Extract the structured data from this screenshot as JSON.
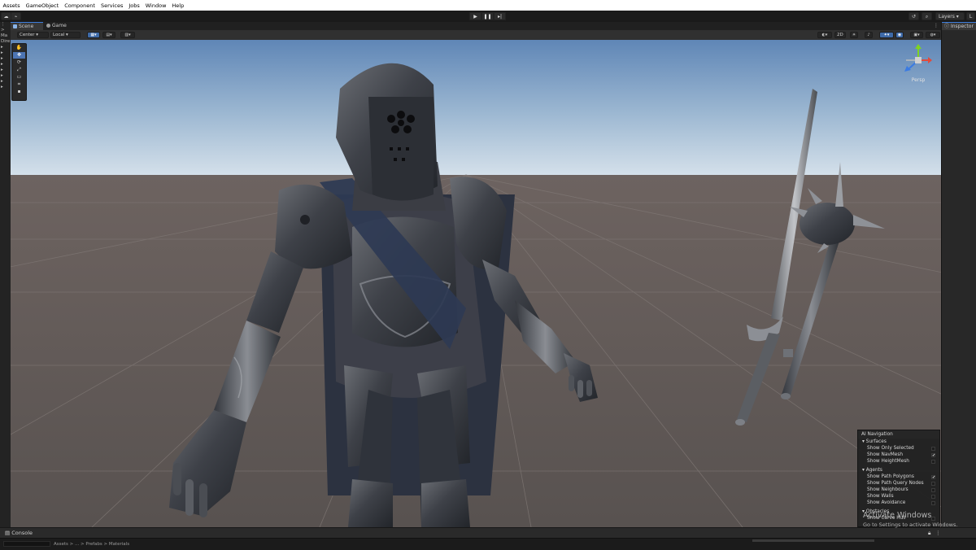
{
  "menubar": [
    "Assets",
    "GameObject",
    "Component",
    "Services",
    "Jobs",
    "Window",
    "Help"
  ],
  "toolbar": {
    "play_icon": "play-icon",
    "pause_icon": "pause-icon",
    "step_icon": "step-icon",
    "layers_label": "Layers"
  },
  "left_panel": {
    "labels": [
      "Ma",
      "Dire"
    ]
  },
  "tabs": {
    "scene": "Scene",
    "game": "Game"
  },
  "scene_toolbar": {
    "pivot_mode": "Center",
    "pivot_rotation": "Local",
    "mode_2d": "2D"
  },
  "tools": [
    "hand-icon",
    "move-icon",
    "rotate-icon",
    "scale-icon",
    "rect-icon",
    "transform-icon"
  ],
  "gizmo": {
    "label": "Persp"
  },
  "ai_navigation": {
    "title": "AI Navigation",
    "surfaces_title": "Surfaces",
    "surfaces": [
      {
        "label": "Show Only Selected",
        "checked": false
      },
      {
        "label": "Show NavMesh",
        "checked": true
      },
      {
        "label": "Show HeightMesh",
        "checked": false
      }
    ],
    "agents_title": "Agents",
    "agents": [
      {
        "label": "Show Path Polygons",
        "checked": true
      },
      {
        "label": "Show Path Query Nodes",
        "checked": false
      },
      {
        "label": "Show Neighbours",
        "checked": false
      },
      {
        "label": "Show Walls",
        "checked": false
      },
      {
        "label": "Show Avoidance",
        "checked": false
      }
    ],
    "obstacles_title": "Obstacles",
    "obstacles": [
      {
        "label": "Show Carve Hull",
        "checked": false
      }
    ]
  },
  "inspector": {
    "tab": "Inspector"
  },
  "console": {
    "label": "Console"
  },
  "status": {
    "breadcrumb": "Assets > ... > Prefabs > Materials"
  },
  "activate_windows": {
    "title": "Activate Windows",
    "subtitle": "Go to Settings to activate Windows."
  }
}
